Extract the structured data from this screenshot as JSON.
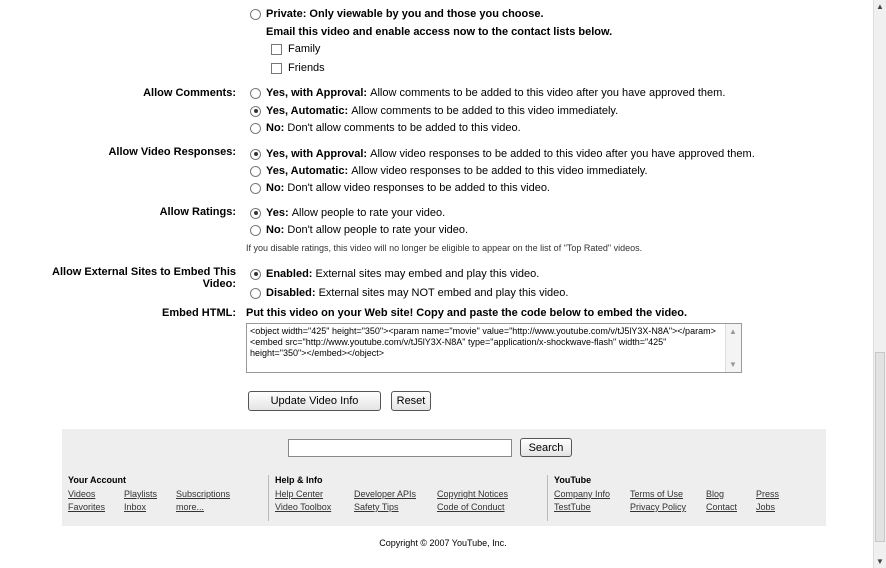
{
  "privacy": {
    "private_bold": "Private:",
    "private_text": "Only viewable by you and those you choose.",
    "email_line": "Email this video and enable access now to the contact lists below.",
    "contacts": [
      "Family",
      "Friends"
    ]
  },
  "comments": {
    "label": "Allow Comments:",
    "options": [
      {
        "bold": "Yes, with Approval:",
        "text": "Allow comments to be added to this video after you have approved them."
      },
      {
        "bold": "Yes, Automatic:",
        "text": "Allow comments to be added to this video immediately."
      },
      {
        "bold": "No:",
        "text": "Don't allow comments to be added to this video."
      }
    ]
  },
  "responses": {
    "label": "Allow Video Responses:",
    "options": [
      {
        "bold": "Yes, with Approval:",
        "text": "Allow video responses to be added to this video after you have approved them."
      },
      {
        "bold": "Yes, Automatic:",
        "text": "Allow video responses to be added to this video immediately."
      },
      {
        "bold": "No:",
        "text": "Don't allow video responses to be added to this video."
      }
    ]
  },
  "ratings": {
    "label": "Allow Ratings:",
    "options": [
      {
        "bold": "Yes:",
        "text": "Allow people to rate your video."
      },
      {
        "bold": "No:",
        "text": "Don't allow people to rate your video."
      }
    ],
    "note": "If you disable ratings, this video will no longer be eligible to appear on the list of \"Top Rated\" videos."
  },
  "external": {
    "label_line1": "Allow External Sites to Embed This",
    "label_line2": "Video:",
    "options": [
      {
        "bold": "Enabled:",
        "text": "External sites may embed and play this video."
      },
      {
        "bold": "Disabled:",
        "text": "External sites may NOT embed and play this video."
      }
    ]
  },
  "embed": {
    "label": "Embed HTML:",
    "headline": "Put this video on your Web site! Copy and paste the code below to embed the video.",
    "code": "<object width=\"425\" height=\"350\"><param name=\"movie\" value=\"http://www.youtube.com/v/tJ5lY3X-N8A\"></param><embed src=\"http://www.youtube.com/v/tJ5lY3X-N8A\" type=\"application/x-shockwave-flash\" width=\"425\" height=\"350\"></embed></object>"
  },
  "buttons": {
    "update": "Update Video Info",
    "reset": "Reset"
  },
  "footer": {
    "search_button": "Search",
    "account": {
      "title": "Your Account",
      "links": [
        "Videos",
        "Playlists",
        "Subscriptions",
        "Favorites",
        "Inbox",
        "more..."
      ]
    },
    "help": {
      "title": "Help & Info",
      "links": [
        "Help Center",
        "Developer APIs",
        "Copyright Notices",
        "Video Toolbox",
        "Safety Tips",
        "Code of Conduct"
      ]
    },
    "youtube": {
      "title": "YouTube",
      "links": [
        "Company Info",
        "Terms of Use",
        "Blog",
        "Press",
        "TestTube",
        "Privacy Policy",
        "Contact",
        "Jobs"
      ]
    },
    "copyright": "Copyright © 2007 YouTube, Inc."
  }
}
